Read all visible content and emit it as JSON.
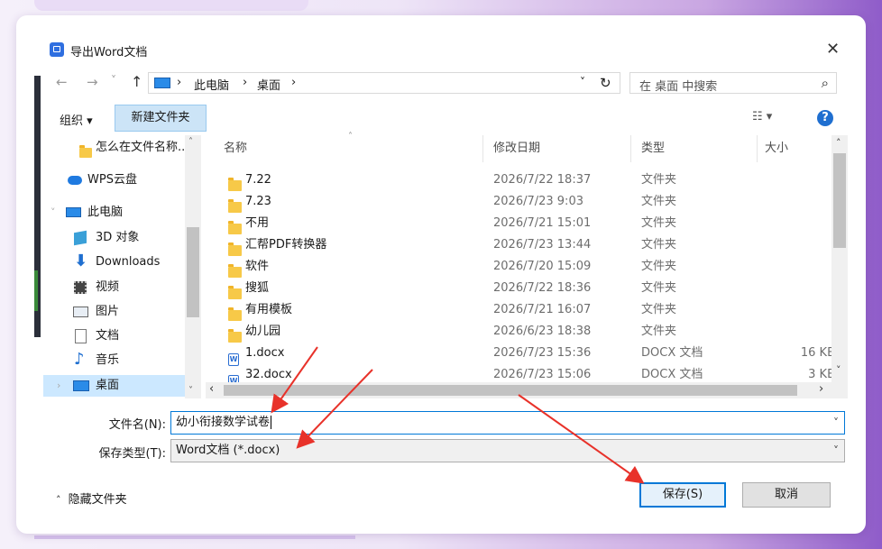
{
  "dialog": {
    "title": "导出Word文档",
    "close_glyph": "✕"
  },
  "address": {
    "back_glyph": "←",
    "forward_glyph": "→",
    "recent_glyph": "˅",
    "up_glyph": "↑",
    "path": [
      "此电脑",
      "桌面"
    ],
    "sep_glyph": "›",
    "dropdown_glyph": "˅",
    "refresh_glyph": "↻",
    "search_placeholder": "在 桌面 中搜索",
    "search_icon_glyph": "⌕"
  },
  "toolbar": {
    "organize": "组织 ▾",
    "new_folder": "新建文件夹",
    "view_glyph": "☷ ▾",
    "help_glyph": "?"
  },
  "nav": [
    {
      "label": "怎么在文件名称..."
    },
    {
      "label": "WPS云盘"
    },
    {
      "label": "此电脑"
    },
    {
      "label": "3D 对象"
    },
    {
      "label": "Downloads"
    },
    {
      "label": "视频"
    },
    {
      "label": "图片"
    },
    {
      "label": "文档"
    },
    {
      "label": "音乐"
    },
    {
      "label": "桌面"
    }
  ],
  "columns": {
    "name": "名称",
    "date": "修改日期",
    "type": "类型",
    "size": "大小"
  },
  "files": [
    {
      "name": "7.22",
      "date": "2026/7/22 18:37",
      "type": "文件夹",
      "size": "",
      "kind": "folder"
    },
    {
      "name": "7.23",
      "date": "2026/7/23 9:03",
      "type": "文件夹",
      "size": "",
      "kind": "folder"
    },
    {
      "name": "不用",
      "date": "2026/7/21 15:01",
      "type": "文件夹",
      "size": "",
      "kind": "folder"
    },
    {
      "name": "汇帮PDF转换器",
      "date": "2026/7/23 13:44",
      "type": "文件夹",
      "size": "",
      "kind": "folder"
    },
    {
      "name": "软件",
      "date": "2026/7/20 15:09",
      "type": "文件夹",
      "size": "",
      "kind": "folder"
    },
    {
      "name": "搜狐",
      "date": "2026/7/22 18:36",
      "type": "文件夹",
      "size": "",
      "kind": "folder"
    },
    {
      "name": "有用模板",
      "date": "2026/7/21 16:07",
      "type": "文件夹",
      "size": "",
      "kind": "folder"
    },
    {
      "name": "幼儿园",
      "date": "2026/6/23 18:38",
      "type": "文件夹",
      "size": "",
      "kind": "folder"
    },
    {
      "name": "1.docx",
      "date": "2026/7/23 15:36",
      "type": "DOCX 文档",
      "size": "16 KB",
      "kind": "docx"
    },
    {
      "name": "32.docx",
      "date": "2026/7/23 15:06",
      "type": "DOCX 文档",
      "size": "3 KB",
      "kind": "docx"
    }
  ],
  "form": {
    "filename_label": "文件名(N):",
    "filename_value": "幼小衔接数学试卷",
    "filetype_label": "保存类型(T):",
    "filetype_value": "Word文档 (*.docx)",
    "combo_glyph": "˅"
  },
  "footer": {
    "hide_folders": "隐藏文件夹",
    "save": "保存(S)",
    "cancel": "取消"
  },
  "colors": {
    "accent": "#0078d7",
    "annotation_arrow": "#e8322a"
  }
}
